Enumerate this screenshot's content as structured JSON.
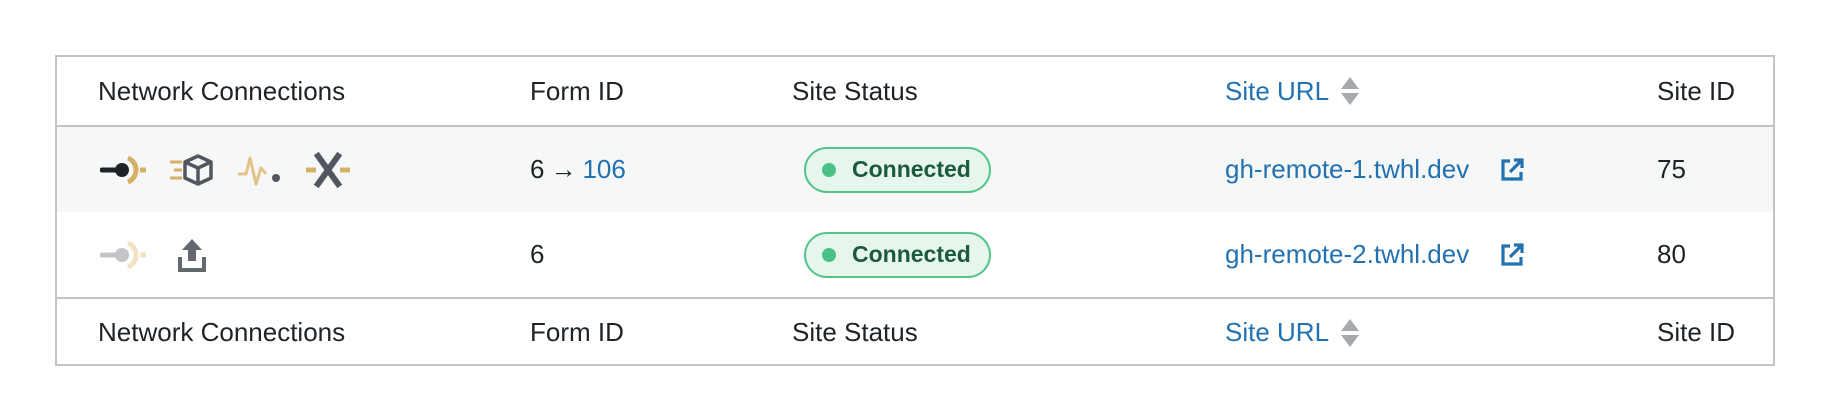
{
  "columns": {
    "network": "Network Connections",
    "form_id": "Form ID",
    "status": "Site Status",
    "url": "Site URL",
    "site_id": "Site ID"
  },
  "rows": [
    {
      "icons": [
        "connection-plug-icon",
        "fast-cube-icon",
        "activity-pulse-icon",
        "crossed-x-icon"
      ],
      "form_id_from": "6",
      "arrow": "→",
      "form_id_to": "106",
      "status": "Connected",
      "url": "gh-remote-1.twhl.dev",
      "site_id": "75"
    },
    {
      "icons": [
        "connection-plug-icon",
        "upload-icon"
      ],
      "form_id_from": "6",
      "status": "Connected",
      "url": "gh-remote-2.twhl.dev",
      "site_id": "80"
    }
  ],
  "colors": {
    "link": "#2271b1",
    "accent_gold": "#d6b067",
    "status_green": "#4cc187",
    "border": "#c3c4c7"
  }
}
